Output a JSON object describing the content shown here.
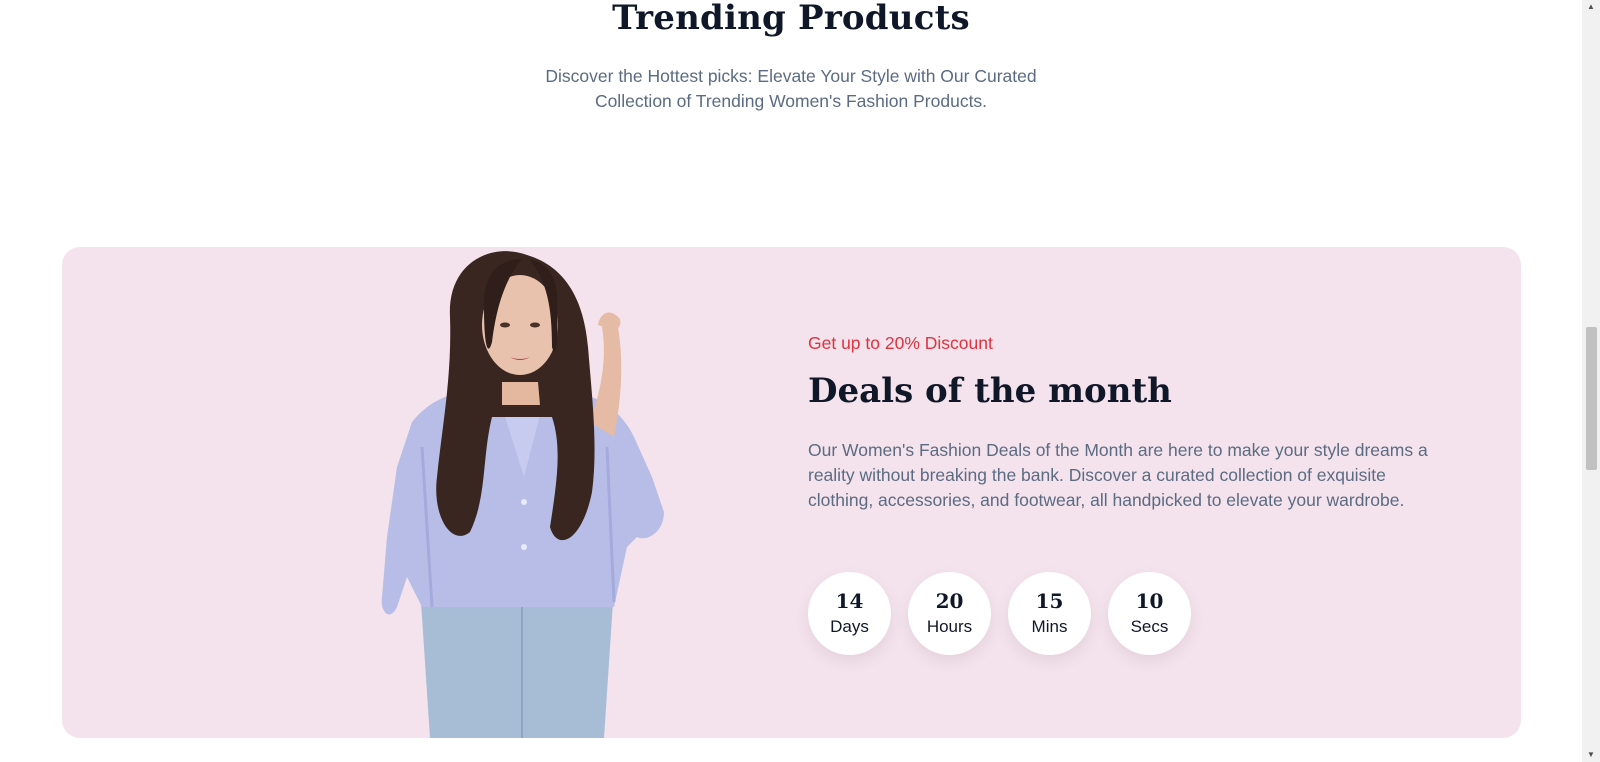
{
  "trending": {
    "title": "Trending Products",
    "subtitle_line1": "Discover the Hottest picks: Elevate Your Style with Our Curated",
    "subtitle_line2": "Collection of Trending Women's Fashion Products."
  },
  "deal": {
    "tag": "Get up to 20% Discount",
    "title": "Deals of the month",
    "description": "Our Women's Fashion Deals of the Month are here to make your style dreams a reality without breaking the bank. Discover a curated collection of exquisite clothing, accessories, and footwear, all handpicked to elevate your wardrobe.",
    "countdown": [
      {
        "value": "14",
        "label": "Days"
      },
      {
        "value": "20",
        "label": "Hours"
      },
      {
        "value": "15",
        "label": "Mins"
      },
      {
        "value": "10",
        "label": "Secs"
      }
    ]
  },
  "colors": {
    "heading": "#0f1729",
    "body_text": "#5b6b82",
    "accent": "#e0323f",
    "card_background": "#f4e3ec"
  },
  "icons": {
    "scroll_up": "triangle-up-icon",
    "scroll_down": "triangle-down-icon"
  }
}
